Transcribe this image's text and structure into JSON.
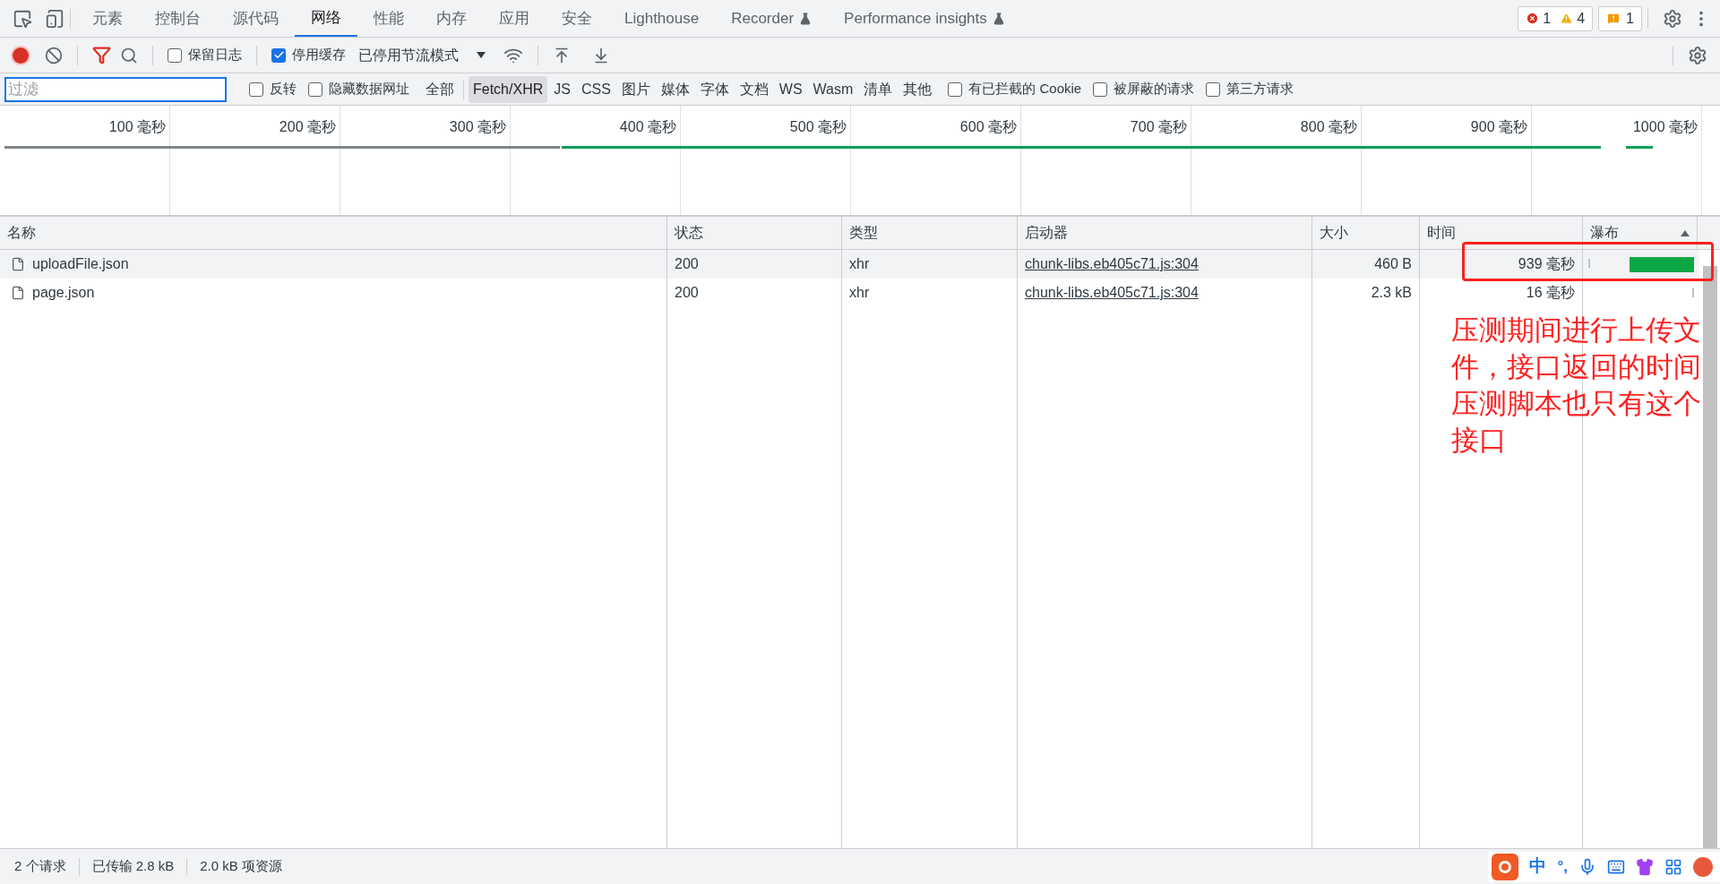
{
  "tabs": [
    {
      "label": "元素",
      "selected": false,
      "experimental": false
    },
    {
      "label": "控制台",
      "selected": false,
      "experimental": false
    },
    {
      "label": "源代码",
      "selected": false,
      "experimental": false
    },
    {
      "label": "网络",
      "selected": true,
      "experimental": false
    },
    {
      "label": "性能",
      "selected": false,
      "experimental": false
    },
    {
      "label": "内存",
      "selected": false,
      "experimental": false
    },
    {
      "label": "应用",
      "selected": false,
      "experimental": false
    },
    {
      "label": "安全",
      "selected": false,
      "experimental": false
    },
    {
      "label": "Lighthouse",
      "selected": false,
      "experimental": false
    },
    {
      "label": "Recorder",
      "selected": false,
      "experimental": true
    },
    {
      "label": "Performance insights",
      "selected": false,
      "experimental": true
    }
  ],
  "counters": {
    "errors": "1",
    "warnings": "4",
    "issues": "1"
  },
  "toolbar": {
    "recording": true,
    "preserve_log": {
      "label": "保留日志",
      "checked": false
    },
    "disable_cache": {
      "label": "停用缓存",
      "checked": true
    },
    "throttling": "已停用节流模式"
  },
  "filter": {
    "placeholder": "过滤",
    "invert": {
      "label": "反转",
      "checked": false
    },
    "hide_data_urls": {
      "label": "隐藏数据网址",
      "checked": false
    },
    "types": [
      {
        "label": "全部",
        "selected": false
      },
      {
        "label": "Fetch/XHR",
        "selected": true
      },
      {
        "label": "JS",
        "selected": false
      },
      {
        "label": "CSS",
        "selected": false
      },
      {
        "label": "图片",
        "selected": false
      },
      {
        "label": "媒体",
        "selected": false
      },
      {
        "label": "字体",
        "selected": false
      },
      {
        "label": "文档",
        "selected": false
      },
      {
        "label": "WS",
        "selected": false
      },
      {
        "label": "Wasm",
        "selected": false
      },
      {
        "label": "清单",
        "selected": false
      },
      {
        "label": "其他",
        "selected": false
      }
    ],
    "options": [
      {
        "label": "有已拦截的 Cookie",
        "checked": false
      },
      {
        "label": "被屏蔽的请求",
        "checked": false
      },
      {
        "label": "第三方请求",
        "checked": false
      }
    ]
  },
  "timeline": {
    "ticks": [
      "100 毫秒",
      "200 毫秒",
      "300 毫秒",
      "400 毫秒",
      "500 毫秒",
      "600 毫秒",
      "700 毫秒",
      "800 毫秒",
      "900 毫秒",
      "1000 毫秒"
    ]
  },
  "table": {
    "columns": [
      "名称",
      "状态",
      "类型",
      "启动器",
      "大小",
      "时间",
      "瀑布"
    ],
    "rows": [
      {
        "name": "uploadFile.json",
        "status": "200",
        "type": "xhr",
        "initiator": "chunk-libs.eb405c71.js:304",
        "size": "460 B",
        "time": "939 毫秒",
        "highlighted": true,
        "kind": "long"
      },
      {
        "name": "page.json",
        "status": "200",
        "type": "xhr",
        "initiator": "chunk-libs.eb405c71.js:304",
        "size": "2.3 kB",
        "time": "16 毫秒",
        "highlighted": false,
        "kind": "short"
      }
    ]
  },
  "annotation": "压测期间进行上传文件，接口返回的时间压测脚本也只有这个接口",
  "status_bar": [
    "2 个请求",
    "已传输 2.8 kB",
    "2.0 kB 项资源"
  ],
  "ime_toolbar": {
    "mode": "中",
    "punctuation": "°,"
  }
}
